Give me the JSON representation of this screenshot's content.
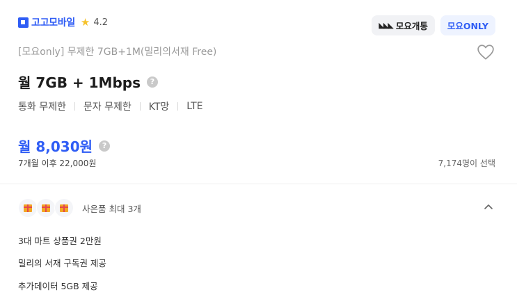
{
  "brand": {
    "name": "고고모바일",
    "rating": "4.2"
  },
  "badges": {
    "network": "모요개통",
    "exclusive": "모요ONLY"
  },
  "plan": {
    "subtitle": "[모요only] 무제한 7GB+1M(밀리의서재 Free)",
    "title": "월 7GB + 1Mbps",
    "specs": [
      "통화 무제한",
      "문자 무제한",
      "KT망",
      "LTE"
    ]
  },
  "pricing": {
    "price": "월 8,030원",
    "after": "7개월 이후 22,000원",
    "selected_count": "7,174명이 선택"
  },
  "gifts": {
    "label": "사은품 최대 3개",
    "benefits": [
      "3대 마트 상품권 2만원",
      "밀리의 서재 구독권 제공",
      "추가데이터 5GB 제공"
    ]
  },
  "colors": {
    "accent": "#2f5df5",
    "star": "#f6c22b"
  },
  "icons": {
    "help": "?",
    "star": "★"
  }
}
